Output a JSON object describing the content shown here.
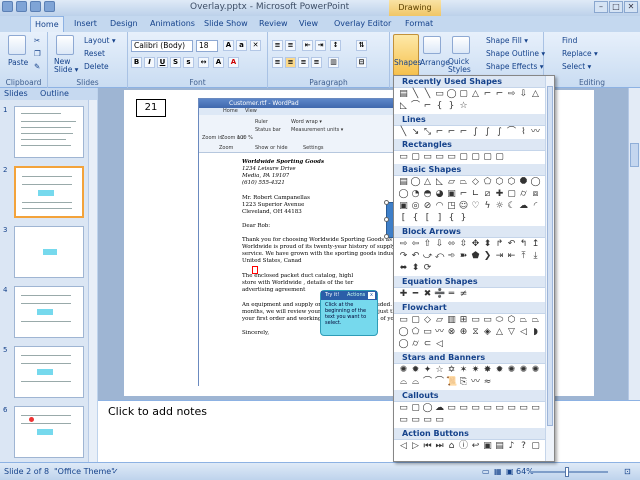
{
  "window": {
    "title": "Overlay.pptx - Microsoft PowerPoint",
    "context_tab": "Drawing Tools"
  },
  "tabs": [
    "Home",
    "Insert",
    "Design",
    "Animations",
    "Slide Show",
    "Review",
    "View",
    "Overlay Editor",
    "Format"
  ],
  "ribbon": {
    "clipboard": {
      "paste": "Paste",
      "label": "Clipboard"
    },
    "slides": {
      "new_slide": "New Slide ▾",
      "layout": "Layout ▾",
      "reset": "Reset",
      "delete": "Delete",
      "label": "Slides"
    },
    "font": {
      "name": "Calibri (Body)",
      "size": "18",
      "label": "Font"
    },
    "paragraph": {
      "label": "Paragraph"
    },
    "drawing": {
      "shapes": "Shapes",
      "arrange": "Arrange",
      "quick_styles": "Quick Styles ▾",
      "shape_fill": "Shape Fill ▾",
      "shape_outline": "Shape Outline ▾",
      "shape_effects": "Shape Effects ▾"
    },
    "editing": {
      "find": "Find",
      "replace": "Replace ▾",
      "select": "Select ▾",
      "label": "Editing"
    }
  },
  "left_pane": {
    "tabs": [
      "Slides",
      "Outline"
    ],
    "thumbnails": [
      "1",
      "2",
      "3",
      "4",
      "5",
      "6"
    ]
  },
  "slide": {
    "number_box": "21",
    "wordpad": {
      "title": "Customer.rtf - WordPad",
      "tabs": [
        "Home",
        "View"
      ],
      "ribbon_items": [
        "Zoom in",
        "Zoom out",
        "100 %",
        "Ruler",
        "Status bar",
        "Word wrap ▾",
        "Measurement units ▾",
        "Zoom",
        "Show or hide",
        "Settings"
      ],
      "letter": [
        "Worldwide Sporting Goods",
        "1234 Leisure Drive",
        "Media, PA 19107",
        "(610) 555-4321",
        "Mr. Robert Campanellas",
        "1223 Superior Avenue",
        "Cleveland, OH  44183",
        "Dear Rob:",
        "Thank you for choosing Worldwide Sporting Goods as your primary",
        "Worldwide is proud of its twenty-year history of supplying quality",
        "service. We have grown with the sporting goods industry, and cur",
        "United States, Canad",
        "The enclosed packet                                   duct catalog, highl",
        "store with Worldwide                                   , details of the ter",
        "advertising agreement",
        "An equipment and supply order form is also included. Your initial",
        "months, we will review your credit status and adjust the limit, as w",
        "your first order and working with you to meet all of your equipmen",
        "Sincerely,"
      ]
    },
    "shape_label": "Se",
    "tooltip": {
      "title": "Try it!",
      "action": "Actions",
      "close": "x",
      "body": "Click at the beginning of the text you want to select."
    }
  },
  "notes": {
    "placeholder": "Click to add notes"
  },
  "status": {
    "slide": "Slide 2 of 8",
    "theme": "\"Office Theme\"",
    "zoom": "64%"
  },
  "shapes_gallery": {
    "sections": [
      "Recently Used Shapes",
      "Lines",
      "Rectangles",
      "Basic Shapes",
      "Block Arrows",
      "Equation Shapes",
      "Flowchart",
      "Stars and Banners",
      "Callouts",
      "Action Buttons"
    ]
  }
}
